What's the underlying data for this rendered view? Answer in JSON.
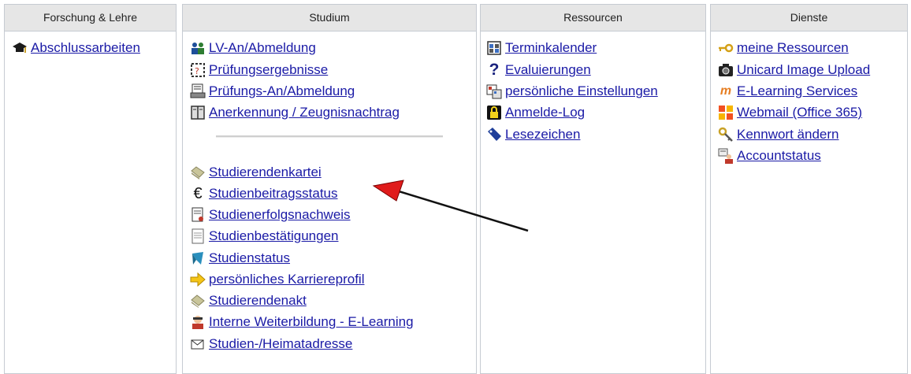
{
  "columns": [
    {
      "title": "Forschung & Lehre",
      "links": [
        {
          "label": "Abschlussarbeiten",
          "icon": "graduation-cap-icon"
        }
      ]
    },
    {
      "title": "Studium",
      "links": [
        {
          "label": "LV-An/Abmeldung",
          "icon": "people-icon"
        },
        {
          "label": "Prüfungsergebnisse",
          "icon": "exam-results-icon"
        },
        {
          "label": "Prüfungs-An/Abmeldung",
          "icon": "printer-icon"
        },
        {
          "label": "Anerkennung / Zeugnisnachtrag",
          "icon": "book-icon"
        },
        {
          "label": "Studierendenkartei",
          "icon": "index-card-icon"
        },
        {
          "label": "Studienbeitragsstatus",
          "icon": "euro-icon"
        },
        {
          "label": "Studienerfolgsnachweis",
          "icon": "certificate-icon"
        },
        {
          "label": "Studienbestätigungen",
          "icon": "document-icon"
        },
        {
          "label": "Studienstatus",
          "icon": "status-icon"
        },
        {
          "label": "persönliches Karriereprofil",
          "icon": "arrow-right-icon"
        },
        {
          "label": "Studierendenakt",
          "icon": "file-stack-icon"
        },
        {
          "label": "Interne Weiterbildung - E-Learning",
          "icon": "learning-icon"
        },
        {
          "label": "Studien-/Heimatadresse",
          "icon": "envelope-icon"
        }
      ]
    },
    {
      "title": "Ressourcen",
      "links": [
        {
          "label": "Terminkalender",
          "icon": "calendar-icon"
        },
        {
          "label": "Evaluierungen",
          "icon": "question-icon"
        },
        {
          "label": "persönliche Einstellungen",
          "icon": "settings-icon"
        },
        {
          "label": "Anmelde-Log",
          "icon": "lock-icon"
        },
        {
          "label": "Lesezeichen",
          "icon": "bookmark-icon"
        }
      ]
    },
    {
      "title": "Dienste",
      "links": [
        {
          "label": "meine Ressourcen",
          "icon": "key-icon"
        },
        {
          "label": "Unicard Image Upload",
          "icon": "camera-icon"
        },
        {
          "label": "E-Learning Services",
          "icon": "moodle-icon"
        },
        {
          "label": "Webmail (Office 365)",
          "icon": "office-icon"
        },
        {
          "label": "Kennwort ändern",
          "icon": "password-key-icon"
        },
        {
          "label": "Accountstatus",
          "icon": "account-icon"
        }
      ]
    }
  ],
  "colors": {
    "link": "#1a1aa6",
    "header_bg": "#e6e6e6",
    "border": "#c6cbd2",
    "annotation_arrow": "#111111"
  }
}
